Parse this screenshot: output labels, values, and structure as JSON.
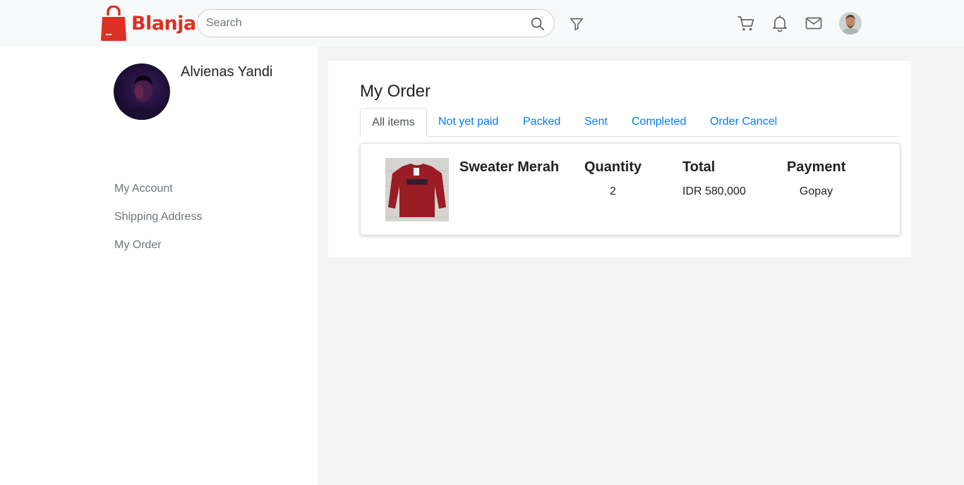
{
  "brand": {
    "name": "Blanja",
    "color": "#db3022"
  },
  "header": {
    "search": {
      "placeholder": "Search",
      "value": ""
    },
    "icons": [
      "search-icon",
      "filter-icon",
      "cart-icon",
      "bell-icon",
      "mail-icon",
      "avatar"
    ]
  },
  "sidebar": {
    "profile_name": "Alvienas Yandi",
    "links": [
      {
        "label": "My Account"
      },
      {
        "label": "Shipping Address"
      },
      {
        "label": "My Order"
      }
    ]
  },
  "main": {
    "title": "My Order",
    "tabs": [
      {
        "label": "All items",
        "active": true
      },
      {
        "label": "Not yet paid",
        "active": false
      },
      {
        "label": "Packed",
        "active": false
      },
      {
        "label": "Sent",
        "active": false
      },
      {
        "label": "Completed",
        "active": false
      },
      {
        "label": "Order Cancel",
        "active": false
      }
    ],
    "columns": {
      "quantity": "Quantity",
      "total": "Total",
      "payment": "Payment"
    },
    "orders": [
      {
        "product_name": "Sweater Merah",
        "quantity": "2",
        "total": "IDR 580,000",
        "payment": "Gopay"
      }
    ]
  },
  "colors": {
    "accent": "#db3022",
    "link": "#007bff",
    "muted": "#6c757d"
  }
}
